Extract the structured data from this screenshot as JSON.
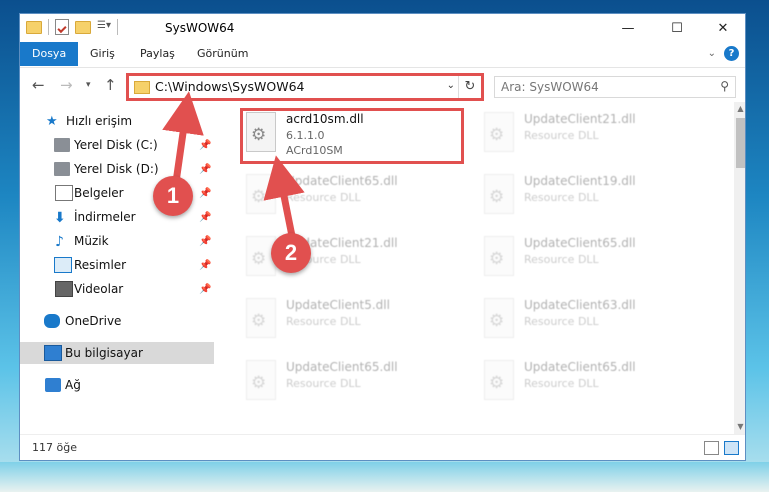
{
  "titlebar": {
    "title": "SysWOW64",
    "minimize": "—",
    "maximize": "☐",
    "close": "✕"
  },
  "ribbon": {
    "tabs": [
      "Dosya",
      "Giriş",
      "Paylaş",
      "Görünüm"
    ],
    "help": "?"
  },
  "address": {
    "path": "C:\\Windows\\SysWOW64",
    "search_placeholder": "Ara: SysWOW64"
  },
  "nav": {
    "items": [
      {
        "label": "Hızlı erişim",
        "icon": "star-icon"
      },
      {
        "label": "Yerel Disk (C:)",
        "icon": "drive-icon",
        "pinned": true
      },
      {
        "label": "Yerel Disk (D:)",
        "icon": "drive-icon",
        "pinned": true
      },
      {
        "label": "Belgeler",
        "icon": "document-icon",
        "pinned": true
      },
      {
        "label": "İndirmeler",
        "icon": "download-icon",
        "pinned": true
      },
      {
        "label": "Müzik",
        "icon": "music-icon",
        "pinned": true
      },
      {
        "label": "Resimler",
        "icon": "pictures-icon",
        "pinned": true
      },
      {
        "label": "Videolar",
        "icon": "video-icon",
        "pinned": true
      },
      {
        "label": "OneDrive",
        "icon": "cloud-icon"
      },
      {
        "label": "Bu bilgisayar",
        "icon": "computer-icon"
      },
      {
        "label": "Ağ",
        "icon": "network-icon"
      }
    ]
  },
  "files": [
    {
      "name": "acrd10sm.dll",
      "line2": "6.1.1.0",
      "line3": "ACrd10SM"
    },
    {
      "name": "UpdateClient21.dll",
      "line2": "Resource DLL",
      "line3": ""
    },
    {
      "name": "UpdateClient65.dll",
      "line2": "Resource DLL",
      "line3": ""
    },
    {
      "name": "UpdateClient19.dll",
      "line2": "Resource DLL",
      "line3": ""
    },
    {
      "name": "UpdateClient21.dll",
      "line2": "Resource DLL",
      "line3": ""
    },
    {
      "name": "UpdateClient65.dll",
      "line2": "Resource DLL",
      "line3": ""
    },
    {
      "name": "UpdateClient5.dll",
      "line2": "Resource DLL",
      "line3": ""
    },
    {
      "name": "UpdateClient63.dll",
      "line2": "Resource DLL",
      "line3": ""
    },
    {
      "name": "UpdateClient65.dll",
      "line2": "Resource DLL",
      "line3": ""
    },
    {
      "name": "UpdateClient65.dll",
      "line2": "Resource DLL",
      "line3": ""
    }
  ],
  "status": {
    "count": "117 öğe"
  },
  "annotations": {
    "badge1": "1",
    "badge2": "2"
  },
  "colors": {
    "accent": "#1979ca",
    "highlight": "#e1504f"
  }
}
